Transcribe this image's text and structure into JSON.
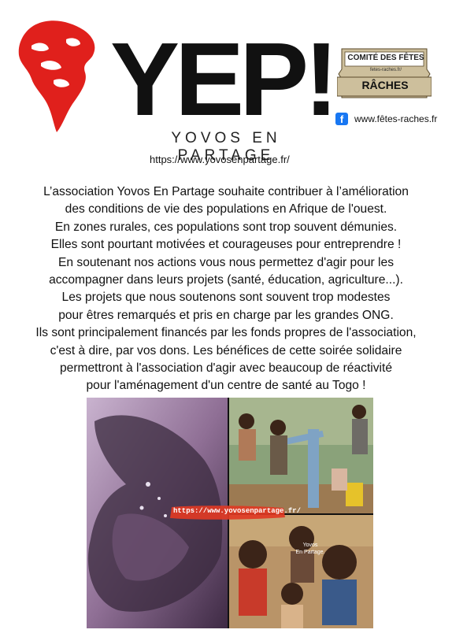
{
  "header": {
    "title": "YEP!",
    "tagline": "YOVOS EN PARTAGE",
    "url": "https://www.yovosenpartage.fr/"
  },
  "badge": {
    "title": "COMITÉ DES FÊTES",
    "url": "fetes-raches.fr/",
    "name": "RÂCHES"
  },
  "facebook": {
    "icon": "facebook-icon",
    "url": "www.fêtes-raches.fr"
  },
  "body_lines": [
    "L’association Yovos En Partage souhaite contribuer à l’amélioration",
    "des conditions de vie des populations en Afrique de l'ouest.",
    "En zones rurales, ces populations sont trop souvent démunies.",
    "Elles sont pourtant motivées et courageuses pour entreprendre !",
    "En soutenant nos actions vous nous permettez d'agir pour les",
    "accompagner dans leurs projets (santé, éducation, agriculture...).",
    "Les projets que nous soutenons sont souvent trop modestes",
    "pour êtres remarqués et pris en charge par les grandes ONG.",
    "Ils sont principalement financés par les fonds propres de l'association,",
    "c'est à dire, par vos dons. Les bénéfices de cette soirée solidaire",
    "permettront à l'association d'agir avec beaucoup de réactivité",
    "pour l'aménagement d'un centre de santé au Togo !"
  ],
  "collage": {
    "overlay_url": "https://www.yovosenpartage.fr/",
    "overlay_brand_line1": "Yovos",
    "overlay_brand_line2": "En Partage."
  },
  "colors": {
    "brand_red": "#e0201c",
    "title_black": "#111111",
    "badge_fill": "#cdbf9c",
    "facebook_blue": "#1877f2"
  }
}
